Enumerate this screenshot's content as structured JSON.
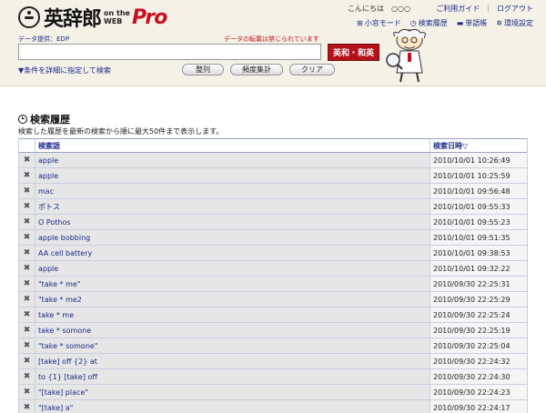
{
  "header": {
    "logo": {
      "main": "英辞郎",
      "sub1": "on the",
      "sub2": "WEB",
      "pro": "Pro"
    },
    "greeting": "こんにちは　○○○",
    "top_links": [
      "ご利用ガイド",
      "ログアウト"
    ],
    "modes": [
      {
        "icon": "window-icon",
        "label": "小窓モード"
      },
      {
        "icon": "history-icon",
        "label": "検索履歴"
      },
      {
        "icon": "book-icon",
        "label": "単語帳"
      },
      {
        "icon": "gear-icon",
        "label": "環境設定"
      }
    ],
    "provider": "データ提供：EDP",
    "warning": "データの転載は禁じられています",
    "search": {
      "value": "",
      "placeholder": ""
    },
    "search_button": "英和・和英",
    "condition_link": "▼条件を詳細に指定して検索",
    "buttons": {
      "sort": "整列",
      "frequency": "頻度集計",
      "clear": "クリア"
    }
  },
  "history": {
    "title": "検索履歴",
    "description": "検索した履歴を最新の検索から順に最大50件まで表示します。",
    "columns": {
      "word": "検索語",
      "date": "検索日時▽"
    },
    "rows": [
      {
        "word": "apple",
        "date": "2010/10/01 10:26:49"
      },
      {
        "word": "apple",
        "date": "2010/10/01 10:25:59"
      },
      {
        "word": "mac",
        "date": "2010/10/01 09:56:48"
      },
      {
        "word": "ポトス",
        "date": "2010/10/01 09:55:33"
      },
      {
        "word": "O Pothos",
        "date": "2010/10/01 09:55:23"
      },
      {
        "word": "apple bobbing",
        "date": "2010/10/01 09:51:35"
      },
      {
        "word": "AA cell battery",
        "date": "2010/10/01 09:38:53"
      },
      {
        "word": "apple",
        "date": "2010/10/01 09:32:22"
      },
      {
        "word": "\"take * me\"",
        "date": "2010/09/30 22:25:31"
      },
      {
        "word": "\"take * me2",
        "date": "2010/09/30 22:25:29"
      },
      {
        "word": "take * me",
        "date": "2010/09/30 22:25:24"
      },
      {
        "word": "take * somone",
        "date": "2010/09/30 22:25:19"
      },
      {
        "word": "\"take * somone\"",
        "date": "2010/09/30 22:25:04"
      },
      {
        "word": "[take] off {2} at",
        "date": "2010/09/30 22:24:32"
      },
      {
        "word": "to {1} [take] off",
        "date": "2010/09/30 22:24:30"
      },
      {
        "word": "\"[take] place\"",
        "date": "2010/09/30 22:24:23"
      },
      {
        "word": "\"[take] a\"",
        "date": "2010/09/30 22:24:17"
      }
    ]
  }
}
